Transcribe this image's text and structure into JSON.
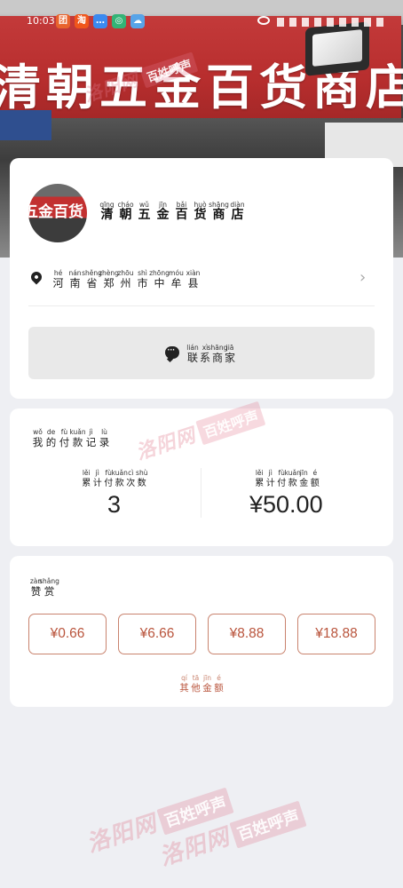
{
  "status_bar": {
    "time": "10:03",
    "app_icons": [
      {
        "name": "app-icon-red",
        "glyph": "团",
        "color": "#e8632c"
      },
      {
        "name": "app-icon-taobao",
        "glyph": "淘",
        "color": "#f0561c"
      },
      {
        "name": "app-icon-message",
        "glyph": "…",
        "color": "#3b8af0"
      },
      {
        "name": "app-icon-green",
        "glyph": "◎",
        "color": "#33b476"
      },
      {
        "name": "app-icon-weather",
        "glyph": "☁",
        "color": "#57a4e8"
      }
    ]
  },
  "header_photo": {
    "sign_text": "清朝五金百货商店"
  },
  "shop": {
    "name_chars": [
      {
        "py": "qīng",
        "hz": "清"
      },
      {
        "py": "cháo",
        "hz": "朝"
      },
      {
        "py": "wǔ",
        "hz": "五"
      },
      {
        "py": "jīn",
        "hz": "金"
      },
      {
        "py": "bǎi",
        "hz": "百"
      },
      {
        "py": "huò",
        "hz": "货"
      },
      {
        "py": "shāng",
        "hz": "商"
      },
      {
        "py": "diàn",
        "hz": "店"
      }
    ],
    "avatar_text": "五金百货",
    "address_chars": [
      {
        "py": "hé",
        "hz": "河"
      },
      {
        "py": "nán",
        "hz": "南"
      },
      {
        "py": "shěng",
        "hz": "省"
      },
      {
        "py": "zhèng",
        "hz": "郑"
      },
      {
        "py": "zhōu",
        "hz": "州"
      },
      {
        "py": "shì",
        "hz": "市"
      },
      {
        "py": "zhōng",
        "hz": "中"
      },
      {
        "py": "móu",
        "hz": "牟"
      },
      {
        "py": "xiàn",
        "hz": "县"
      }
    ],
    "contact_chars": [
      {
        "py": "lián",
        "hz": "联"
      },
      {
        "py": "xì",
        "hz": "系"
      },
      {
        "py": "shāng",
        "hz": "商"
      },
      {
        "py": "jiā",
        "hz": "家"
      }
    ]
  },
  "payment_record": {
    "title_chars": [
      {
        "py": "wǒ",
        "hz": "我"
      },
      {
        "py": "de",
        "hz": "的"
      },
      {
        "py": "fù",
        "hz": "付"
      },
      {
        "py": "kuǎn",
        "hz": "款"
      },
      {
        "py": "jì",
        "hz": "记"
      },
      {
        "py": "lù",
        "hz": "录"
      }
    ],
    "count_label_chars": [
      {
        "py": "lěi",
        "hz": "累"
      },
      {
        "py": "jì",
        "hz": "计"
      },
      {
        "py": "fù",
        "hz": "付"
      },
      {
        "py": "kuǎn",
        "hz": "款"
      },
      {
        "py": "cì",
        "hz": "次"
      },
      {
        "py": "shù",
        "hz": "数"
      }
    ],
    "amount_label_chars": [
      {
        "py": "lěi",
        "hz": "累"
      },
      {
        "py": "jì",
        "hz": "计"
      },
      {
        "py": "fù",
        "hz": "付"
      },
      {
        "py": "kuǎn",
        "hz": "款"
      },
      {
        "py": "jīn",
        "hz": "金"
      },
      {
        "py": "é",
        "hz": "额"
      }
    ],
    "count_value": "3",
    "amount_value": "¥50.00"
  },
  "tip": {
    "title_chars": [
      {
        "py": "zàn",
        "hz": "赞"
      },
      {
        "py": "shǎng",
        "hz": "赏"
      }
    ],
    "amounts": [
      "¥0.66",
      "¥6.66",
      "¥8.88",
      "¥18.88"
    ],
    "other_chars": [
      {
        "py": "qí",
        "hz": "其"
      },
      {
        "py": "tā",
        "hz": "他"
      },
      {
        "py": "jīn",
        "hz": "金"
      },
      {
        "py": "é",
        "hz": "额"
      }
    ]
  },
  "watermark": {
    "script_text": "洛阳网",
    "box_text": "百姓呼声"
  },
  "colors": {
    "accent": "#b9543c",
    "accent_border": "#c9836e",
    "page_bg": "#eeeff3"
  }
}
